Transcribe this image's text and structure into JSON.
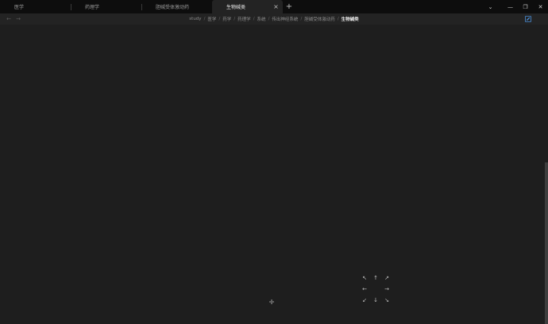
{
  "tabs": [
    {
      "label": "医学",
      "active": false
    },
    {
      "label": "药理学",
      "active": false
    },
    {
      "label": "胆碱受体激动药",
      "active": false
    },
    {
      "label": "生物碱类",
      "active": true
    }
  ],
  "tab_close_glyph": "×",
  "new_tab_glyph": "+",
  "window_controls": {
    "dropdown": "⌄",
    "minimize": "—",
    "restore": "❐",
    "close": "✕"
  },
  "nav": {
    "back": "←",
    "forward": "→"
  },
  "breadcrumb": [
    "study",
    "医学",
    "药学",
    "药理学",
    "系统",
    "传出神经系统",
    "胆碱受体激动药",
    "生物碱类"
  ],
  "breadcrumb_separator": "/",
  "icons": {
    "edit": "edit-icon"
  },
  "accent_color": "#4a8fd8",
  "nav_pad": {
    "up_left": "↖",
    "up": "↑",
    "up_right": "↗",
    "left": "←",
    "right": "→",
    "down_left": "↙",
    "down": "↓",
    "down_right": "↘"
  },
  "center_glyph": "✛"
}
